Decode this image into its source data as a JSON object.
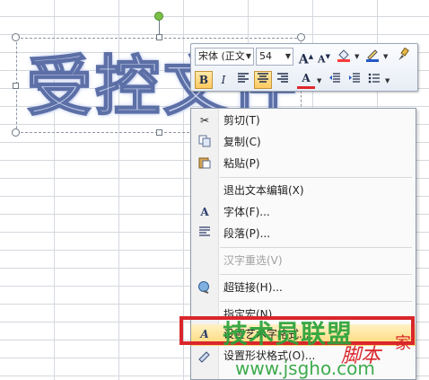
{
  "wordart": {
    "text": "受控文件"
  },
  "mini_toolbar": {
    "font_name": "宋体 (正文",
    "font_size": "54",
    "grow_font": "A",
    "shrink_font": "A",
    "bold": "B",
    "italic": "I",
    "font_color": "A"
  },
  "context_menu": {
    "items": [
      {
        "label": "剪切(T)",
        "icon": "scissors-icon"
      },
      {
        "label": "复制(C)",
        "icon": "copy-icon"
      },
      {
        "label": "粘贴(P)",
        "icon": "paste-icon"
      },
      {
        "label": "退出文本编辑(X)",
        "icon": ""
      },
      {
        "label": "字体(F)...",
        "icon": "font-icon"
      },
      {
        "label": "段落(P)...",
        "icon": "paragraph-icon"
      },
      {
        "label": "汉字重选(V)",
        "icon": "",
        "disabled": true
      },
      {
        "label": "超链接(H)...",
        "icon": "hyperlink-icon"
      },
      {
        "label": "指定宏(N)...",
        "icon": ""
      },
      {
        "label": "设置艺术字格式...",
        "icon": "wordart-format-icon"
      },
      {
        "label": "设置形状格式(O)...",
        "icon": "shape-format-icon"
      }
    ]
  },
  "watermark": {
    "brand": "技术员联盟",
    "url": "www.jsgho.com",
    "jia": "家",
    "script": "脚本"
  },
  "colors": {
    "highlight": "#d9262b",
    "selection": "#ffd975",
    "watermark": "#2aa33b"
  }
}
